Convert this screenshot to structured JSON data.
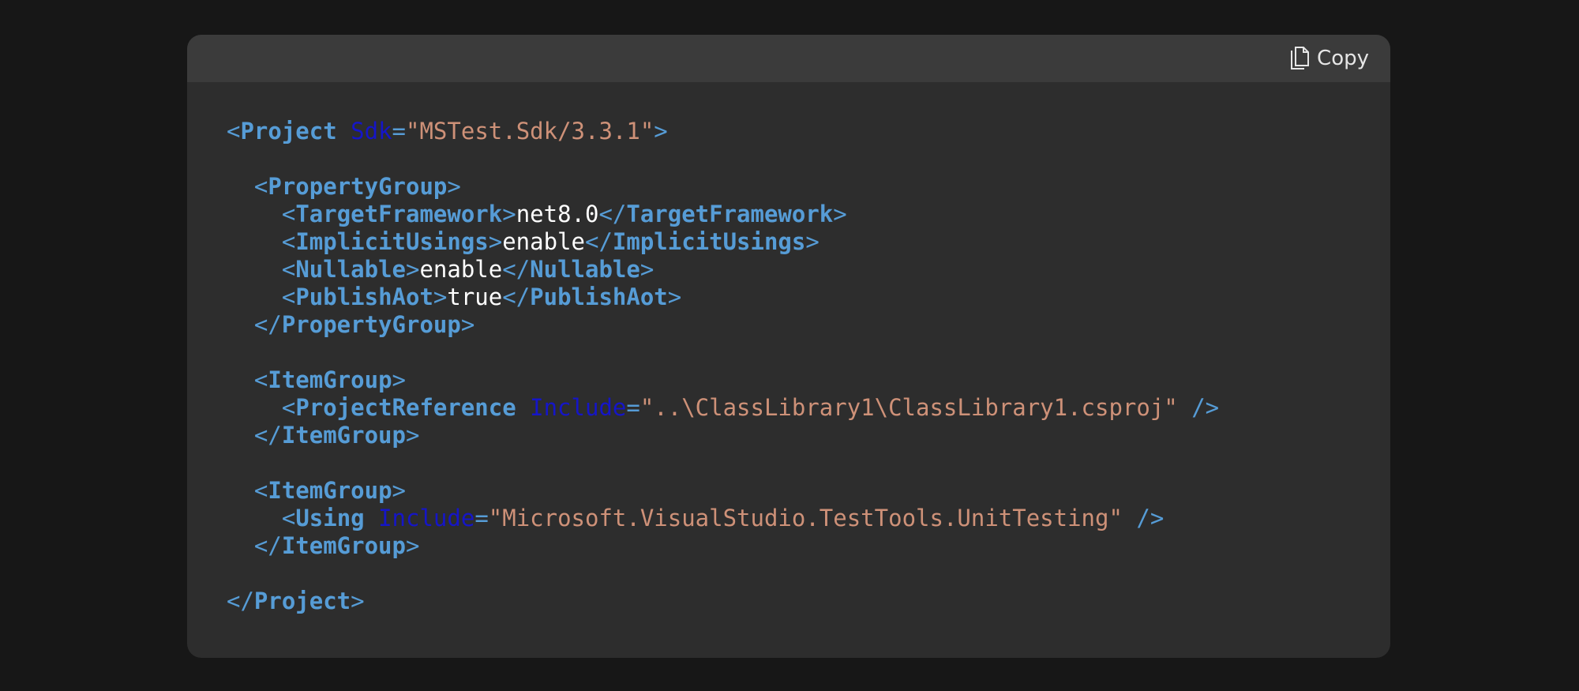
{
  "toolbar": {
    "copy_label": "Copy",
    "copy_icon": "copy-icon"
  },
  "code": {
    "language": "xml",
    "lines": [
      [
        {
          "t": "punc",
          "v": "<"
        },
        {
          "t": "tag",
          "v": "Project"
        },
        {
          "t": "txt",
          "v": " "
        },
        {
          "t": "attr",
          "v": "Sdk"
        },
        {
          "t": "punc",
          "v": "="
        },
        {
          "t": "str",
          "v": "\"MSTest.Sdk/3.3.1\""
        },
        {
          "t": "punc",
          "v": ">"
        }
      ],
      [],
      [
        {
          "t": "txt",
          "v": "  "
        },
        {
          "t": "punc",
          "v": "<"
        },
        {
          "t": "tag",
          "v": "PropertyGroup"
        },
        {
          "t": "punc",
          "v": ">"
        }
      ],
      [
        {
          "t": "txt",
          "v": "    "
        },
        {
          "t": "punc",
          "v": "<"
        },
        {
          "t": "tag",
          "v": "TargetFramework"
        },
        {
          "t": "punc",
          "v": ">"
        },
        {
          "t": "txt",
          "v": "net8.0"
        },
        {
          "t": "punc",
          "v": "</"
        },
        {
          "t": "tag",
          "v": "TargetFramework"
        },
        {
          "t": "punc",
          "v": ">"
        }
      ],
      [
        {
          "t": "txt",
          "v": "    "
        },
        {
          "t": "punc",
          "v": "<"
        },
        {
          "t": "tag",
          "v": "ImplicitUsings"
        },
        {
          "t": "punc",
          "v": ">"
        },
        {
          "t": "txt",
          "v": "enable"
        },
        {
          "t": "punc",
          "v": "</"
        },
        {
          "t": "tag",
          "v": "ImplicitUsings"
        },
        {
          "t": "punc",
          "v": ">"
        }
      ],
      [
        {
          "t": "txt",
          "v": "    "
        },
        {
          "t": "punc",
          "v": "<"
        },
        {
          "t": "tag",
          "v": "Nullable"
        },
        {
          "t": "punc",
          "v": ">"
        },
        {
          "t": "txt",
          "v": "enable"
        },
        {
          "t": "punc",
          "v": "</"
        },
        {
          "t": "tag",
          "v": "Nullable"
        },
        {
          "t": "punc",
          "v": ">"
        }
      ],
      [
        {
          "t": "txt",
          "v": "    "
        },
        {
          "t": "punc",
          "v": "<"
        },
        {
          "t": "tag",
          "v": "PublishAot"
        },
        {
          "t": "punc",
          "v": ">"
        },
        {
          "t": "txt",
          "v": "true"
        },
        {
          "t": "punc",
          "v": "</"
        },
        {
          "t": "tag",
          "v": "PublishAot"
        },
        {
          "t": "punc",
          "v": ">"
        }
      ],
      [
        {
          "t": "txt",
          "v": "  "
        },
        {
          "t": "punc",
          "v": "</"
        },
        {
          "t": "tag",
          "v": "PropertyGroup"
        },
        {
          "t": "punc",
          "v": ">"
        }
      ],
      [],
      [
        {
          "t": "txt",
          "v": "  "
        },
        {
          "t": "punc",
          "v": "<"
        },
        {
          "t": "tag",
          "v": "ItemGroup"
        },
        {
          "t": "punc",
          "v": ">"
        }
      ],
      [
        {
          "t": "txt",
          "v": "    "
        },
        {
          "t": "punc",
          "v": "<"
        },
        {
          "t": "tag",
          "v": "ProjectReference"
        },
        {
          "t": "txt",
          "v": " "
        },
        {
          "t": "attr",
          "v": "Include"
        },
        {
          "t": "punc",
          "v": "="
        },
        {
          "t": "str",
          "v": "\"..\\ClassLibrary1\\ClassLibrary1.csproj\""
        },
        {
          "t": "txt",
          "v": " "
        },
        {
          "t": "punc",
          "v": "/>"
        }
      ],
      [
        {
          "t": "txt",
          "v": "  "
        },
        {
          "t": "punc",
          "v": "</"
        },
        {
          "t": "tag",
          "v": "ItemGroup"
        },
        {
          "t": "punc",
          "v": ">"
        }
      ],
      [],
      [
        {
          "t": "txt",
          "v": "  "
        },
        {
          "t": "punc",
          "v": "<"
        },
        {
          "t": "tag",
          "v": "ItemGroup"
        },
        {
          "t": "punc",
          "v": ">"
        }
      ],
      [
        {
          "t": "txt",
          "v": "    "
        },
        {
          "t": "punc",
          "v": "<"
        },
        {
          "t": "tag",
          "v": "Using"
        },
        {
          "t": "txt",
          "v": " "
        },
        {
          "t": "attr",
          "v": "Include"
        },
        {
          "t": "punc",
          "v": "="
        },
        {
          "t": "str",
          "v": "\"Microsoft.VisualStudio.TestTools.UnitTesting\""
        },
        {
          "t": "txt",
          "v": " "
        },
        {
          "t": "punc",
          "v": "/>"
        }
      ],
      [
        {
          "t": "txt",
          "v": "  "
        },
        {
          "t": "punc",
          "v": "</"
        },
        {
          "t": "tag",
          "v": "ItemGroup"
        },
        {
          "t": "punc",
          "v": ">"
        }
      ],
      [],
      [
        {
          "t": "punc",
          "v": "</"
        },
        {
          "t": "tag",
          "v": "Project"
        },
        {
          "t": "punc",
          "v": ">"
        }
      ]
    ]
  },
  "colors": {
    "page_background": "#171717",
    "block_background": "#2d2d2d",
    "header_background": "#3b3b3b",
    "tag": "#569cd6",
    "attribute": "#1515c8",
    "string": "#ce9178",
    "text": "#ffffff"
  }
}
